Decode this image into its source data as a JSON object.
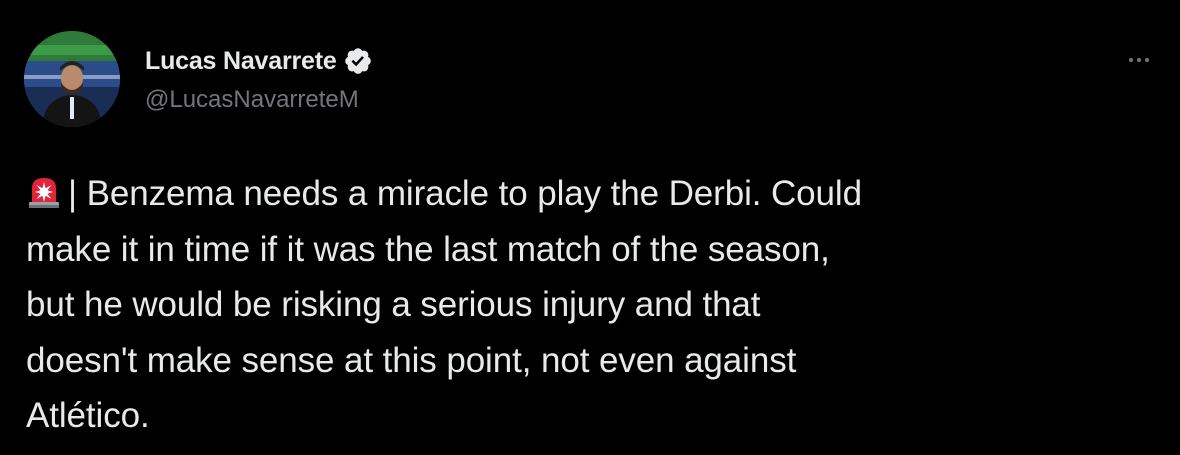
{
  "author": {
    "display_name": "Lucas Navarrete",
    "handle": "@LucasNavarreteM",
    "verified": true,
    "avatar_icon": "profile-photo-stadium"
  },
  "tweet": {
    "emoji_icon": "rotating-light-siren",
    "lines": [
      "| Benzema needs a miracle to play the Derbi. Could",
      "make it in time if it was the last match of the season,",
      "but he would be risking a serious injury and that",
      "doesn't make sense at this point, not even against",
      "Atlético."
    ]
  },
  "menu_icon": "more-options-ellipsis",
  "colors": {
    "background": "#000000",
    "primary_text": "#e7e9ea",
    "secondary_text": "#71767b",
    "siren_red": "#e0243a"
  }
}
